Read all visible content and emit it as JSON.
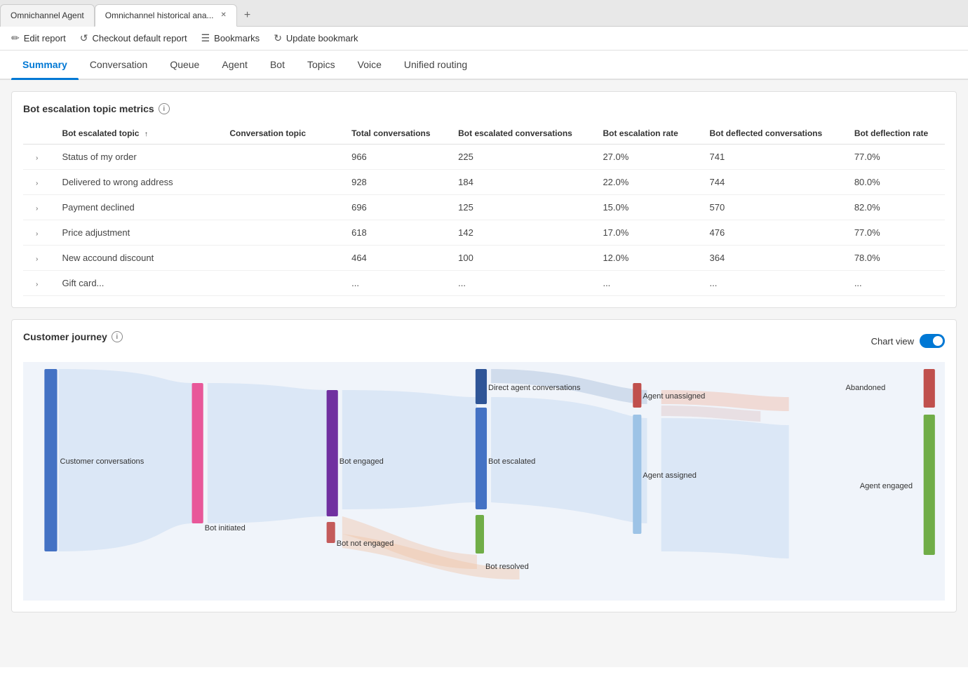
{
  "browser": {
    "tabs": [
      {
        "id": "tab1",
        "label": "Omnichannel Agent",
        "active": false,
        "closable": false
      },
      {
        "id": "tab2",
        "label": "Omnichannel historical ana...",
        "active": true,
        "closable": true
      }
    ],
    "new_tab_label": "+"
  },
  "toolbar": {
    "items": [
      {
        "id": "edit",
        "icon": "✏",
        "label": "Edit report"
      },
      {
        "id": "checkout",
        "icon": "↺",
        "label": "Checkout default report"
      },
      {
        "id": "bookmarks",
        "icon": "☰",
        "label": "Bookmarks"
      },
      {
        "id": "update",
        "icon": "↻",
        "label": "Update bookmark"
      }
    ]
  },
  "nav": {
    "tabs": [
      {
        "id": "summary",
        "label": "Summary",
        "active": true
      },
      {
        "id": "conversation",
        "label": "Conversation",
        "active": false
      },
      {
        "id": "queue",
        "label": "Queue",
        "active": false
      },
      {
        "id": "agent",
        "label": "Agent",
        "active": false
      },
      {
        "id": "bot",
        "label": "Bot",
        "active": false
      },
      {
        "id": "topics",
        "label": "Topics",
        "active": false
      },
      {
        "id": "voice",
        "label": "Voice",
        "active": false
      },
      {
        "id": "unified_routing",
        "label": "Unified routing",
        "active": false
      }
    ]
  },
  "bot_escalation": {
    "title": "Bot escalation topic metrics",
    "columns": [
      {
        "id": "expand",
        "label": ""
      },
      {
        "id": "topic",
        "label": "Bot escalated topic",
        "sortable": true
      },
      {
        "id": "conv_topic",
        "label": "Conversation topic"
      },
      {
        "id": "total",
        "label": "Total conversations"
      },
      {
        "id": "escalated",
        "label": "Bot escalated conversations"
      },
      {
        "id": "esc_rate",
        "label": "Bot escalation rate"
      },
      {
        "id": "deflected",
        "label": "Bot deflected conversations"
      },
      {
        "id": "defl_rate",
        "label": "Bot deflection rate"
      }
    ],
    "rows": [
      {
        "topic": "Status of my order",
        "conv_topic": "",
        "total": "966",
        "escalated": "225",
        "esc_rate": "27.0%",
        "deflected": "741",
        "defl_rate": "77.0%"
      },
      {
        "topic": "Delivered to wrong address",
        "conv_topic": "",
        "total": "928",
        "escalated": "184",
        "esc_rate": "22.0%",
        "deflected": "744",
        "defl_rate": "80.0%"
      },
      {
        "topic": "Payment declined",
        "conv_topic": "",
        "total": "696",
        "escalated": "125",
        "esc_rate": "15.0%",
        "deflected": "570",
        "defl_rate": "82.0%"
      },
      {
        "topic": "Price adjustment",
        "conv_topic": "",
        "total": "618",
        "escalated": "142",
        "esc_rate": "17.0%",
        "deflected": "476",
        "defl_rate": "77.0%"
      },
      {
        "topic": "New accound discount",
        "conv_topic": "",
        "total": "464",
        "escalated": "100",
        "esc_rate": "12.0%",
        "deflected": "364",
        "defl_rate": "78.0%"
      },
      {
        "topic": "Gift card...",
        "conv_topic": "",
        "total": "...",
        "escalated": "...",
        "esc_rate": "...",
        "deflected": "...",
        "defl_rate": "..."
      }
    ]
  },
  "customer_journey": {
    "title": "Customer journey",
    "chart_view_label": "Chart view",
    "toggle_on": true,
    "nodes": [
      {
        "id": "customer_conv",
        "label": "Customer conversations",
        "color": "#4472C4"
      },
      {
        "id": "bot_initiated",
        "label": "Bot initiated",
        "color": "#E85799"
      },
      {
        "id": "bot_engaged",
        "label": "Bot engaged",
        "color": "#7030A0"
      },
      {
        "id": "bot_not_engaged",
        "label": "Bot not engaged",
        "color": "#C45B5B"
      },
      {
        "id": "bot_escalated",
        "label": "Bot escalated",
        "color": "#4472C4"
      },
      {
        "id": "bot_resolved",
        "label": "Bot resolved",
        "color": "#70AD47"
      },
      {
        "id": "direct_agent",
        "label": "Direct agent conversations",
        "color": "#2F5597"
      },
      {
        "id": "agent_unassigned",
        "label": "Agent unassigned",
        "color": "#C0504D"
      },
      {
        "id": "abandoned",
        "label": "Abandoned",
        "color": "#C0504D"
      },
      {
        "id": "agent_assigned",
        "label": "Agent assigned",
        "color": "#9DC3E6"
      },
      {
        "id": "agent_engaged",
        "label": "Agent engaged",
        "color": "#70AD47"
      }
    ]
  }
}
